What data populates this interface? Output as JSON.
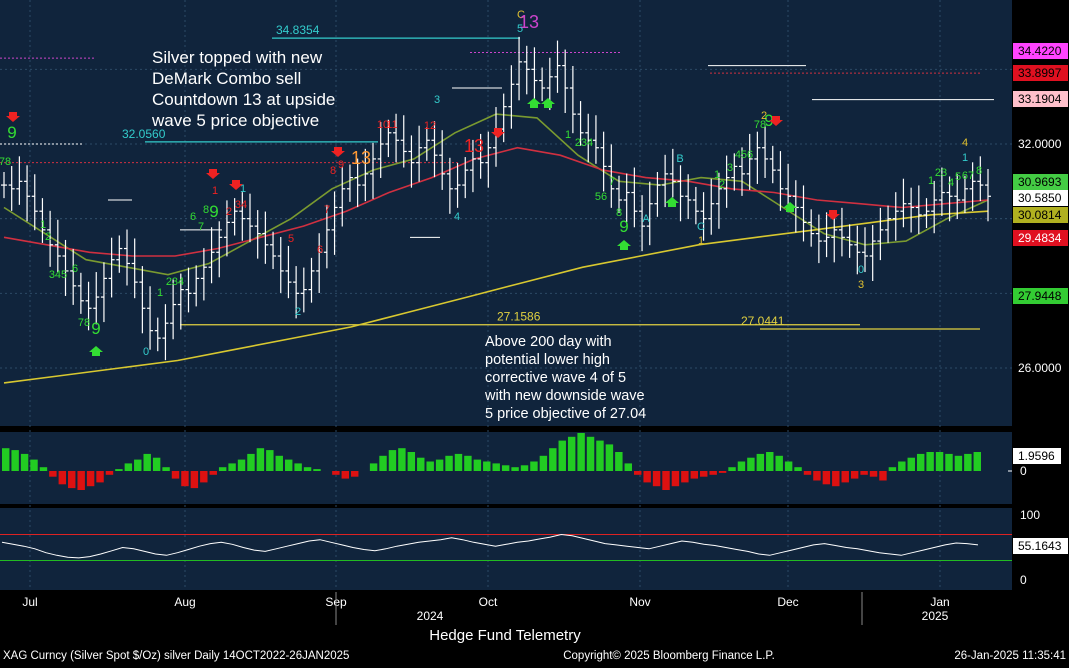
{
  "chart_data": {
    "type": "candlestick",
    "title": "Hedge Fund Telemetry",
    "footer": {
      "left": "XAG Curncy (Silver Spot  $/Oz) silver  Daily 14OCT2022-26JAN2025",
      "center": "Copyright© 2025 Bloomberg Finance L.P.",
      "right": "26-Jan-2025 11:35:41"
    },
    "x_ticks": [
      "Jul",
      "Aug",
      "Sep",
      "Oct",
      "Nov",
      "Dec",
      "Jan"
    ],
    "year_labels": [
      "2024",
      "2025"
    ],
    "y_ticks": [
      26.0,
      28.0,
      30.0,
      32.0,
      34.0
    ],
    "y_tick_labels": [
      "26.0000",
      "32.0000"
    ],
    "ylim": [
      24.6,
      36.0
    ],
    "annotations": [
      {
        "text": "Silver topped with new",
        "group": "top"
      },
      {
        "text": "DeMark Combo sell",
        "group": "top"
      },
      {
        "text": "Countdown 13 at upside",
        "group": "top"
      },
      {
        "text": "wave 5 price objective",
        "group": "top"
      },
      {
        "text": "Above 200 day with",
        "group": "bottom"
      },
      {
        "text": "potential lower high",
        "group": "bottom"
      },
      {
        "text": "corrective wave 4 of 5",
        "group": "bottom"
      },
      {
        "text": "with new downside wave",
        "group": "bottom"
      },
      {
        "text": "5 price objective of 27.04",
        "group": "bottom"
      }
    ],
    "levels": [
      {
        "label": "34.8354",
        "value": 34.8354,
        "color": "#33cccc"
      },
      {
        "label": "32.0560",
        "value": 32.056,
        "color": "#33cccc"
      },
      {
        "label": "27.1586",
        "value": 27.1586,
        "color": "#e0d040"
      },
      {
        "label": "27.0441",
        "value": 27.0441,
        "color": "#e0d040"
      }
    ],
    "price_badges": [
      {
        "label": "34.4220",
        "value": 34.422,
        "bg": "#ff44ff",
        "fg": "#000000"
      },
      {
        "label": "33.8997",
        "value": 33.8997,
        "bg": "#e01020",
        "fg": "#000000"
      },
      {
        "label": "33.1904",
        "value": 33.1904,
        "bg": "#ffc0cb",
        "fg": "#000000"
      },
      {
        "label": "30.9693",
        "value": 30.9693,
        "bg": "#44cc44",
        "fg": "#000000"
      },
      {
        "label": "30.5850",
        "value": 30.585,
        "bg": "#ffffff",
        "fg": "#000000"
      },
      {
        "label": "30.0814",
        "value": 30.0814,
        "bg": "#b0b020",
        "fg": "#000000"
      },
      {
        "label": "29.4834",
        "value": 29.4834,
        "bg": "#e01020",
        "fg": "#ffffff"
      },
      {
        "label": "27.9448",
        "value": 27.9448,
        "bg": "#33cc33",
        "fg": "#000000"
      }
    ],
    "series": [
      {
        "name": "price",
        "color": "#ffffff",
        "close": [
          30.9,
          30.8,
          31.0,
          30.6,
          30.2,
          29.7,
          29.3,
          29.0,
          28.6,
          28.2,
          27.8,
          27.6,
          27.9,
          28.4,
          28.9,
          29.2,
          28.8,
          28.3,
          27.6,
          27.0,
          26.8,
          27.2,
          27.7,
          28.1,
          28.0,
          28.4,
          28.7,
          29.1,
          29.5,
          29.9,
          30.2,
          30.0,
          29.8,
          29.6,
          29.3,
          29.0,
          28.6,
          28.3,
          28.0,
          28.1,
          28.6,
          29.1,
          29.7,
          30.3,
          30.8,
          31.1,
          30.9,
          31.2,
          31.6,
          32.0,
          32.3,
          32.1,
          31.8,
          31.5,
          31.9,
          32.1,
          31.7,
          31.2,
          30.8,
          30.9,
          31.3,
          31.6,
          31.5,
          31.9,
          32.4,
          33.0,
          33.6,
          34.2,
          34.0,
          33.7,
          33.5,
          33.8,
          34.1,
          33.5,
          32.8,
          32.3,
          32.1,
          31.9,
          31.4,
          30.8,
          30.5,
          30.7,
          30.2,
          29.8,
          30.4,
          30.9,
          31.2,
          31.0,
          30.6,
          30.5,
          30.2,
          30.0,
          30.4,
          30.8,
          31.1,
          31.4,
          31.2,
          31.6,
          31.9,
          31.6,
          31.3,
          30.8,
          30.6,
          30.3,
          29.9,
          29.6,
          29.4,
          29.5,
          29.7,
          29.5,
          29.3,
          29.1,
          29.0,
          29.4,
          29.7,
          30.0,
          30.2,
          30.4,
          30.3,
          30.1,
          30.2,
          30.5,
          30.7,
          30.6,
          30.5,
          30.8,
          31.0,
          30.9,
          30.6
        ]
      },
      {
        "name": "ma_short",
        "color": "#7a9a30",
        "values": [
          30.3,
          29.6,
          28.9,
          28.7,
          28.5,
          28.8,
          29.4,
          30.0,
          30.8,
          31.3,
          31.6,
          32.3,
          32.8,
          32.7,
          31.7,
          31.0,
          30.9,
          31.1,
          31.0,
          30.3,
          29.6,
          29.3,
          29.4,
          30.0,
          30.5
        ]
      },
      {
        "name": "ma_mid",
        "color": "#d03040",
        "values": [
          29.5,
          29.3,
          29.1,
          29.0,
          29.0,
          29.2,
          29.5,
          29.8,
          30.2,
          30.7,
          31.1,
          31.6,
          31.9,
          31.7,
          31.3,
          31.1,
          31.0,
          30.8,
          30.7,
          30.5,
          30.4,
          30.3,
          30.4,
          30.5
        ]
      },
      {
        "name": "ma_200",
        "color": "#d8c830",
        "values": [
          25.6,
          25.8,
          26.0,
          26.2,
          26.5,
          26.8,
          27.1,
          27.5,
          27.9,
          28.3,
          28.7,
          29.0,
          29.3,
          29.5,
          29.7,
          29.9,
          30.1,
          30.2
        ]
      }
    ],
    "macd": {
      "label": "1.9596",
      "zero_label": "0",
      "values": [
        0.6,
        0.55,
        0.45,
        0.3,
        0.1,
        -0.15,
        -0.35,
        -0.45,
        -0.5,
        -0.4,
        -0.3,
        -0.1,
        0.05,
        0.2,
        0.3,
        0.45,
        0.35,
        0.1,
        -0.2,
        -0.4,
        -0.45,
        -0.3,
        -0.1,
        0.1,
        0.2,
        0.3,
        0.45,
        0.6,
        0.55,
        0.4,
        0.3,
        0.2,
        0.1,
        0.05,
        0.0,
        -0.1,
        -0.2,
        -0.15,
        0.0,
        0.2,
        0.4,
        0.55,
        0.6,
        0.5,
        0.35,
        0.25,
        0.3,
        0.4,
        0.45,
        0.4,
        0.3,
        0.25,
        0.2,
        0.15,
        0.1,
        0.15,
        0.25,
        0.4,
        0.6,
        0.8,
        0.9,
        1.0,
        0.9,
        0.8,
        0.7,
        0.5,
        0.2,
        -0.1,
        -0.3,
        -0.4,
        -0.5,
        -0.4,
        -0.3,
        -0.2,
        -0.15,
        -0.1,
        -0.05,
        0.1,
        0.25,
        0.35,
        0.45,
        0.5,
        0.4,
        0.25,
        0.1,
        -0.1,
        -0.25,
        -0.35,
        -0.4,
        -0.3,
        -0.2,
        -0.1,
        -0.15,
        -0.25,
        0.1,
        0.25,
        0.35,
        0.45,
        0.5,
        0.5,
        0.45,
        0.4,
        0.45,
        0.5
      ]
    },
    "rsi": {
      "label": "55.1643",
      "ticks": [
        "100",
        "0"
      ],
      "values": [
        58,
        55,
        52,
        48,
        42,
        38,
        35,
        34,
        36,
        40,
        45,
        50,
        48,
        44,
        40,
        38,
        42,
        47,
        52,
        56,
        58,
        55,
        50,
        46,
        44,
        48,
        52,
        56,
        60,
        62,
        58,
        54,
        50,
        47,
        45,
        48,
        52,
        55,
        58,
        60,
        62,
        65,
        62,
        58,
        55,
        52,
        55,
        58,
        60,
        63,
        66,
        70,
        68,
        64,
        60,
        56,
        54,
        52,
        50,
        48,
        52,
        56,
        60,
        58,
        55,
        53,
        50,
        47,
        44,
        40,
        38,
        42,
        46,
        50,
        54,
        56,
        53,
        50,
        48,
        45,
        42,
        40,
        38,
        42,
        46,
        50,
        54,
        57,
        56,
        54
      ]
    },
    "demark": [
      {
        "t": "9",
        "x": 12,
        "y": 138,
        "c": "#33dd33",
        "s": 17
      },
      {
        "t": "78",
        "x": 5,
        "y": 165,
        "c": "#33dd33",
        "s": 11
      },
      {
        "t": "1",
        "x": 43,
        "y": 228,
        "c": "#33dd33",
        "s": 11
      },
      {
        "t": "2",
        "x": 48,
        "y": 240,
        "c": "#33dd33",
        "s": 11
      },
      {
        "t": "345",
        "x": 58,
        "y": 278,
        "c": "#33dd33",
        "s": 11
      },
      {
        "t": "6",
        "x": 75,
        "y": 272,
        "c": "#33dd33",
        "s": 11
      },
      {
        "t": "78",
        "x": 84,
        "y": 326,
        "c": "#33dd33",
        "s": 11
      },
      {
        "t": "9",
        "x": 96,
        "y": 334,
        "c": "#33dd33",
        "s": 17
      },
      {
        "t": "0",
        "x": 146,
        "y": 355,
        "c": "#33cccc",
        "s": 11
      },
      {
        "t": "1",
        "x": 160,
        "y": 296,
        "c": "#33dd33",
        "s": 11
      },
      {
        "t": "234",
        "x": 175,
        "y": 285,
        "c": "#33dd33",
        "s": 11
      },
      {
        "t": "6",
        "x": 193,
        "y": 220,
        "c": "#33dd33",
        "s": 11
      },
      {
        "t": "7",
        "x": 201,
        "y": 230,
        "c": "#33dd33",
        "s": 11
      },
      {
        "t": "8",
        "x": 206,
        "y": 213,
        "c": "#33dd33",
        "s": 11
      },
      {
        "t": "9",
        "x": 214,
        "y": 217,
        "c": "#33dd33",
        "s": 17
      },
      {
        "t": "2",
        "x": 229,
        "y": 215,
        "c": "#ee2222",
        "s": 11
      },
      {
        "t": "34",
        "x": 241,
        "y": 208,
        "c": "#ee2222",
        "s": 11
      },
      {
        "t": "1",
        "x": 215,
        "y": 194,
        "c": "#ee2222",
        "s": 11
      },
      {
        "t": "1",
        "x": 243,
        "y": 192,
        "c": "#33cccc",
        "s": 11
      },
      {
        "t": "5",
        "x": 291,
        "y": 242,
        "c": "#ee2222",
        "s": 11
      },
      {
        "t": "6",
        "x": 320,
        "y": 253,
        "c": "#ee2222",
        "s": 11
      },
      {
        "t": "7",
        "x": 327,
        "y": 213,
        "c": "#ee2222",
        "s": 11
      },
      {
        "t": "2",
        "x": 298,
        "y": 315,
        "c": "#33cccc",
        "s": 11
      },
      {
        "t": "8",
        "x": 333,
        "y": 174,
        "c": "#ee2222",
        "s": 11
      },
      {
        "t": "9",
        "x": 341,
        "y": 168,
        "c": "#ee2222",
        "s": 11
      },
      {
        "t": "13",
        "x": 361,
        "y": 164,
        "c": "#ff9933",
        "s": 18
      },
      {
        "t": "10",
        "x": 383,
        "y": 128,
        "c": "#ee2222",
        "s": 11
      },
      {
        "t": "11",
        "x": 392,
        "y": 128,
        "c": "#ee2222",
        "s": 11
      },
      {
        "t": "12",
        "x": 430,
        "y": 129,
        "c": "#ee2222",
        "s": 11
      },
      {
        "t": "3",
        "x": 437,
        "y": 103,
        "c": "#33cccc",
        "s": 11
      },
      {
        "t": "13",
        "x": 474,
        "y": 152,
        "c": "#ee2222",
        "s": 18
      },
      {
        "t": "4",
        "x": 457,
        "y": 220,
        "c": "#33cccc",
        "s": 11
      },
      {
        "t": "C",
        "x": 521,
        "y": 18,
        "c": "#e0c030",
        "s": 11
      },
      {
        "t": "13",
        "x": 529,
        "y": 28,
        "c": "#cc44cc",
        "s": 18
      },
      {
        "t": "5",
        "x": 520,
        "y": 32,
        "c": "#33cccc",
        "s": 11
      },
      {
        "t": "1",
        "x": 568,
        "y": 138,
        "c": "#33dd33",
        "s": 11
      },
      {
        "t": "234",
        "x": 584,
        "y": 146,
        "c": "#33dd33",
        "s": 11
      },
      {
        "t": "56",
        "x": 601,
        "y": 200,
        "c": "#33dd33",
        "s": 11
      },
      {
        "t": "7",
        "x": 612,
        "y": 185,
        "c": "#33dd33",
        "s": 11
      },
      {
        "t": "8",
        "x": 619,
        "y": 216,
        "c": "#33dd33",
        "s": 11
      },
      {
        "t": "9",
        "x": 624,
        "y": 232,
        "c": "#33dd33",
        "s": 17
      },
      {
        "t": "A",
        "x": 646,
        "y": 222,
        "c": "#33cccc",
        "s": 11
      },
      {
        "t": "B",
        "x": 680,
        "y": 162,
        "c": "#33cccc",
        "s": 11
      },
      {
        "t": "C",
        "x": 701,
        "y": 230,
        "c": "#33cccc",
        "s": 11
      },
      {
        "t": "1",
        "x": 701,
        "y": 244,
        "c": "#e0c030",
        "s": 11
      },
      {
        "t": "1",
        "x": 717,
        "y": 178,
        "c": "#33dd33",
        "s": 11
      },
      {
        "t": "2",
        "x": 722,
        "y": 188,
        "c": "#33dd33",
        "s": 11
      },
      {
        "t": "3",
        "x": 730,
        "y": 171,
        "c": "#33dd33",
        "s": 11
      },
      {
        "t": "456",
        "x": 744,
        "y": 158,
        "c": "#33dd33",
        "s": 11
      },
      {
        "t": "78",
        "x": 760,
        "y": 128,
        "c": "#33dd33",
        "s": 11
      },
      {
        "t": "9",
        "x": 769,
        "y": 126,
        "c": "#33dd33",
        "s": 17
      },
      {
        "t": "2",
        "x": 764,
        "y": 119,
        "c": "#e0c030",
        "s": 11
      },
      {
        "t": "0",
        "x": 861,
        "y": 273,
        "c": "#33cccc",
        "s": 11
      },
      {
        "t": "3",
        "x": 861,
        "y": 288,
        "c": "#e0c030",
        "s": 11
      },
      {
        "t": "1",
        "x": 931,
        "y": 184,
        "c": "#33dd33",
        "s": 11
      },
      {
        "t": "23",
        "x": 941,
        "y": 176,
        "c": "#33dd33",
        "s": 11
      },
      {
        "t": "4",
        "x": 951,
        "y": 186,
        "c": "#33dd33",
        "s": 11
      },
      {
        "t": "5",
        "x": 958,
        "y": 180,
        "c": "#33dd33",
        "s": 11
      },
      {
        "t": "67",
        "x": 968,
        "y": 179,
        "c": "#33dd33",
        "s": 11
      },
      {
        "t": "8",
        "x": 979,
        "y": 174,
        "c": "#33dd33",
        "s": 11
      },
      {
        "t": "1",
        "x": 965,
        "y": 161,
        "c": "#33cccc",
        "s": 11
      },
      {
        "t": "4",
        "x": 965,
        "y": 146,
        "c": "#e0c030",
        "s": 11
      }
    ]
  }
}
